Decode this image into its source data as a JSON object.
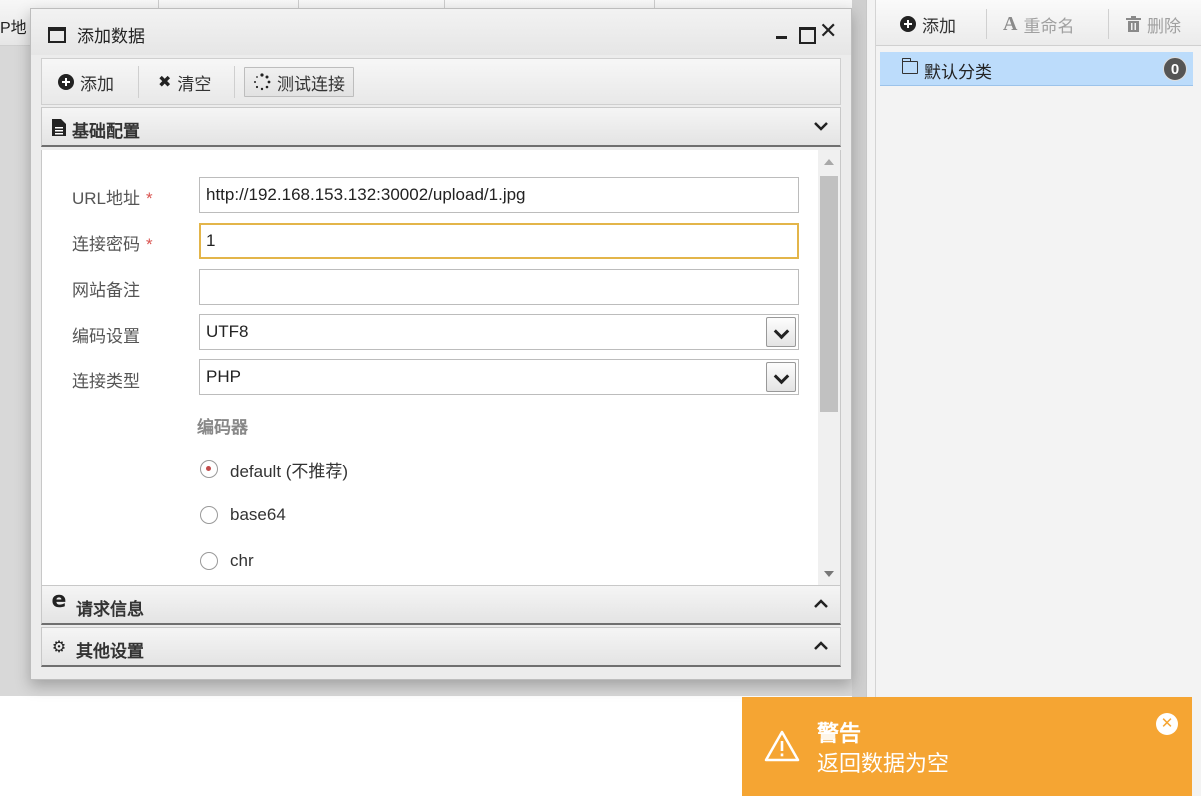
{
  "background": {
    "header_fragment": "P地"
  },
  "right_panel": {
    "toolbar": {
      "add_label": "添加",
      "rename_label": "重命名",
      "delete_label": "删除"
    },
    "category": {
      "label": "默认分类",
      "count": "0"
    }
  },
  "dialog": {
    "title": "添加数据",
    "toolbar": {
      "add_label": "添加",
      "clear_label": "清空",
      "test_label": "测试连接"
    },
    "sections": {
      "basic": "基础配置",
      "request": "请求信息",
      "other": "其他设置"
    },
    "form": {
      "url_label": "URL地址",
      "url_value": "http://192.168.153.132:30002/upload/1.jpg",
      "password_label": "连接密码",
      "password_value": "1",
      "note_label": "网站备注",
      "note_value": "",
      "encoding_label": "编码设置",
      "encoding_value": "UTF8",
      "type_label": "连接类型",
      "type_value": "PHP",
      "required_mark": "*",
      "encoder_label": "编码器",
      "encoders": [
        {
          "label": "default (不推荐)",
          "checked": true
        },
        {
          "label": "base64",
          "checked": false
        },
        {
          "label": "chr",
          "checked": false
        }
      ]
    }
  },
  "toast": {
    "title": "警告",
    "message": "返回数据为空",
    "color": "#f5a533"
  }
}
